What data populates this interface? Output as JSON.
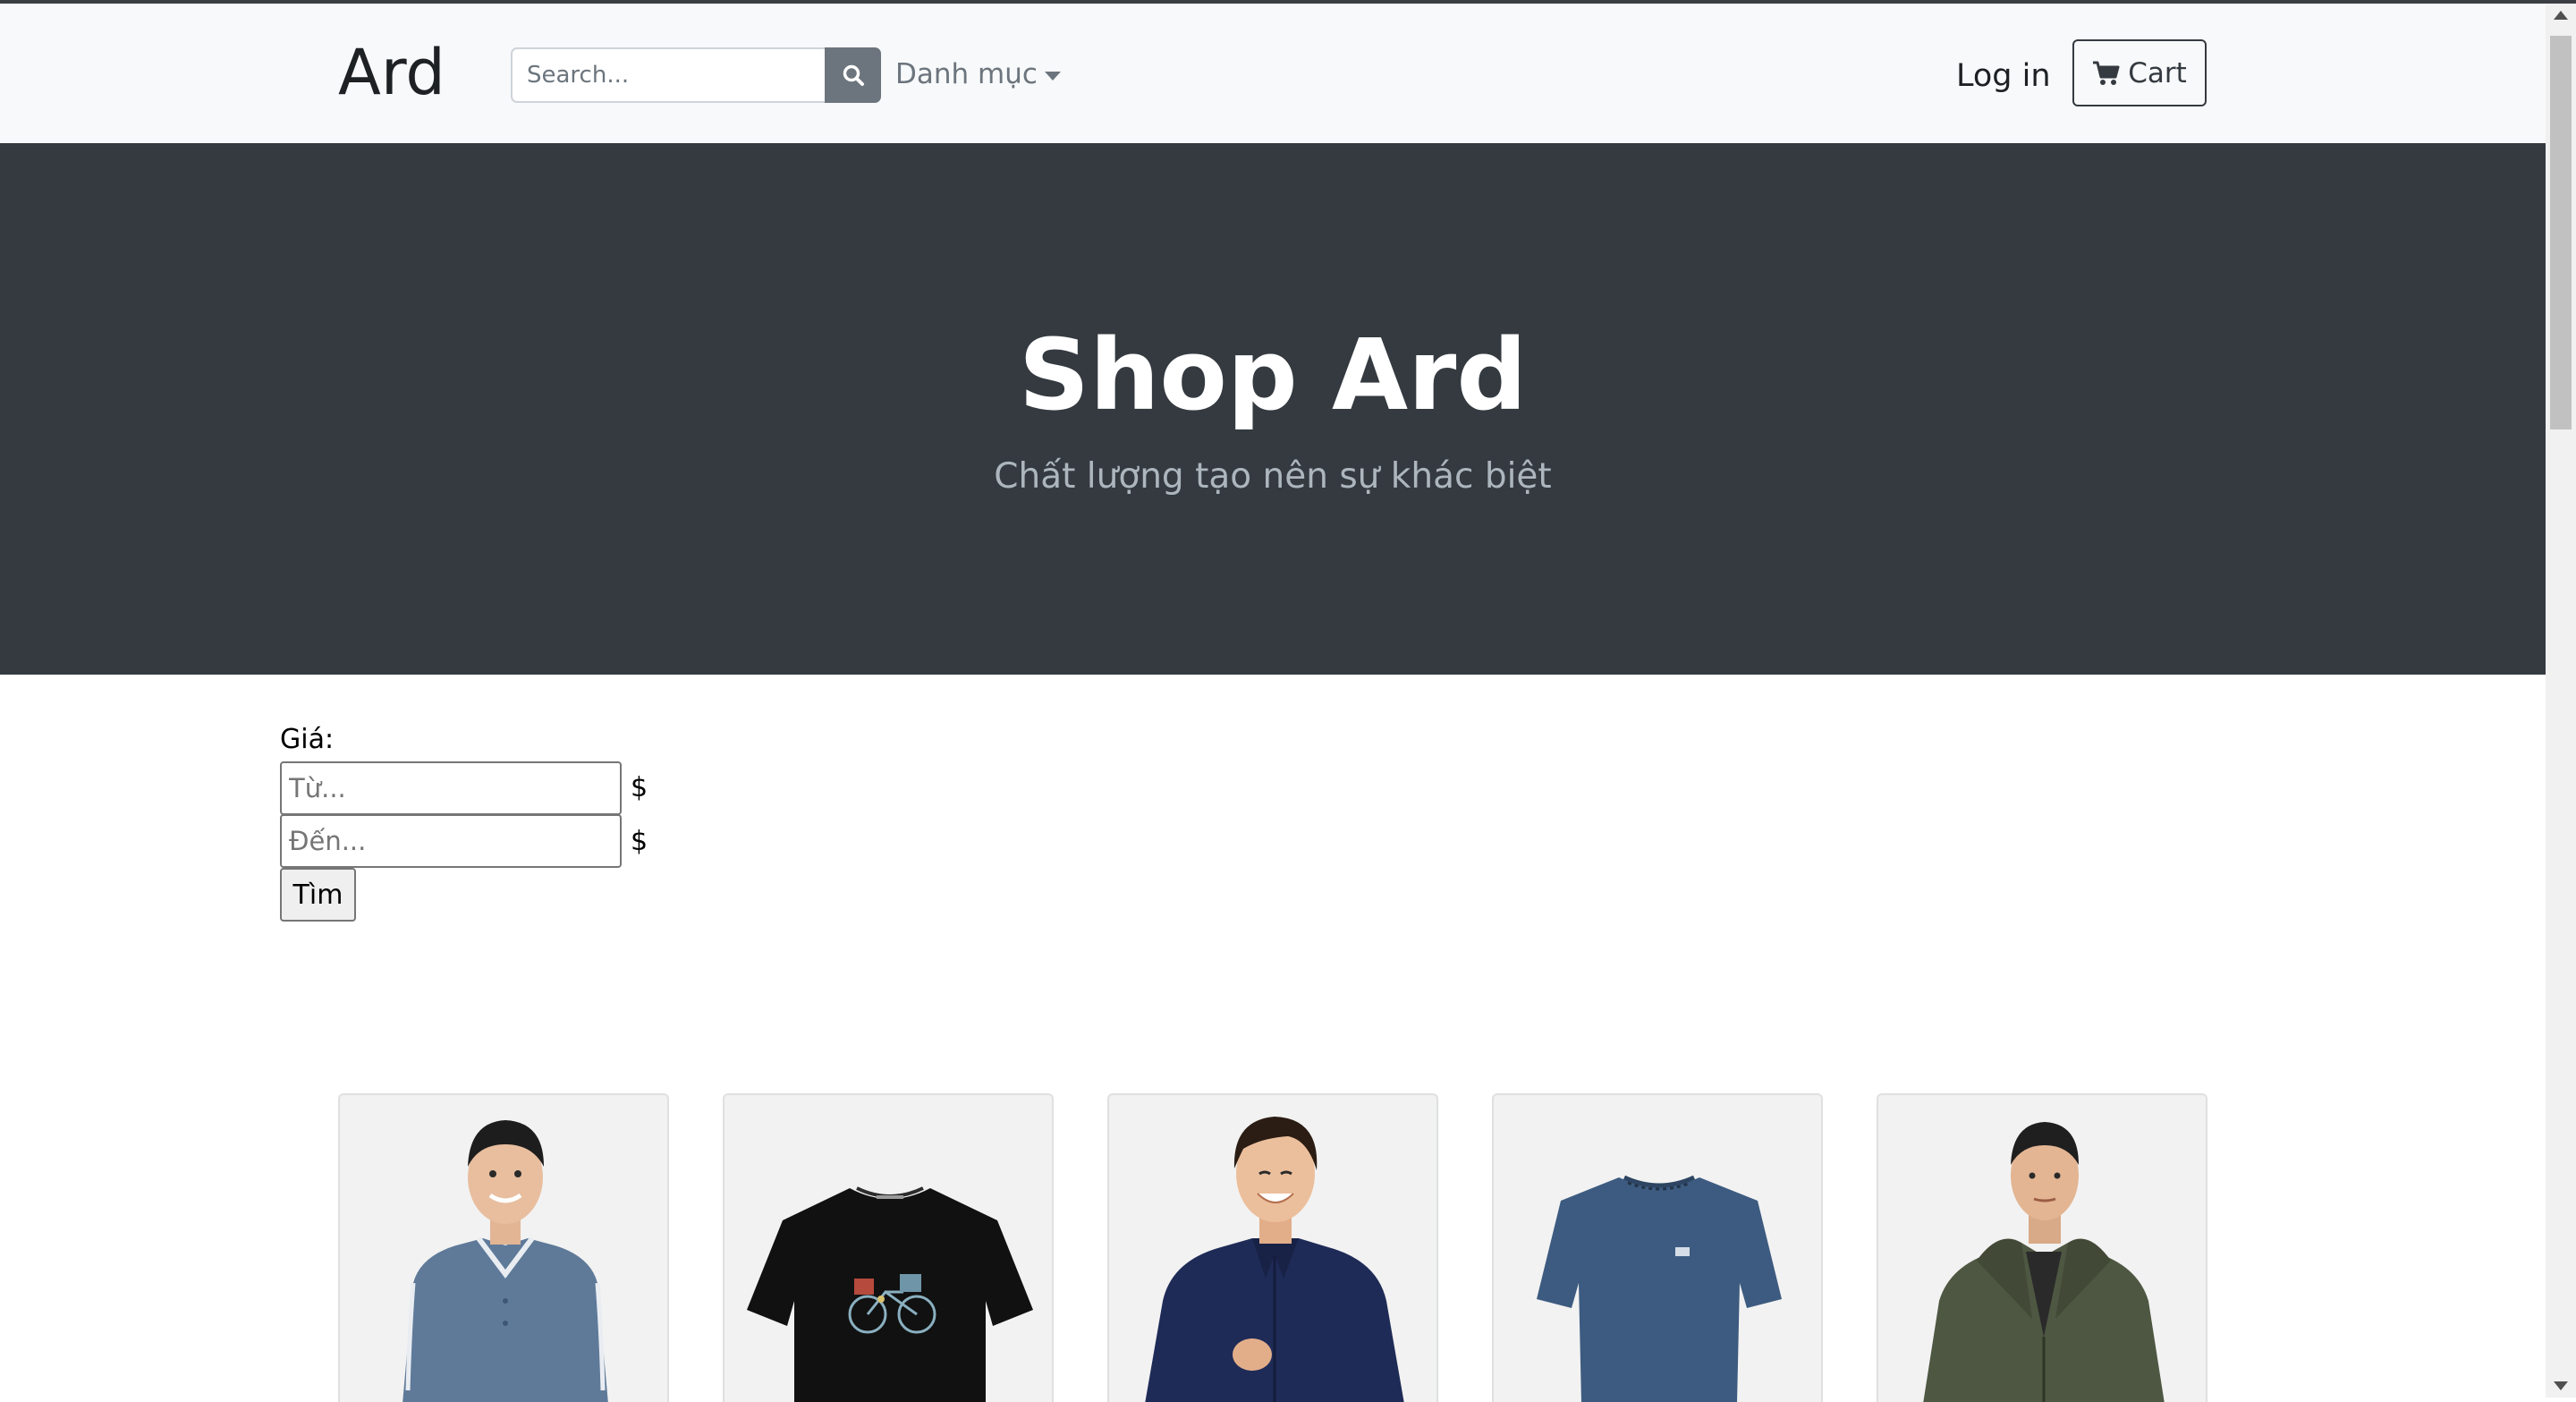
{
  "navbar": {
    "brand": "Ard",
    "search_placeholder": "Search...",
    "search_icon": "search-icon",
    "category_label": "Danh mục",
    "login_label": "Log in",
    "cart_label": "Cart",
    "cart_icon": "cart-icon"
  },
  "hero": {
    "title": "Shop Ard",
    "subtitle": "Chất lượng tạo nên sự khác biệt"
  },
  "filter": {
    "label": "Giá:",
    "from_placeholder": "Từ...",
    "to_placeholder": "Đến...",
    "currency": "$",
    "submit_label": "Tìm"
  },
  "products": [
    {
      "image": "man-in-grey-blue-polo-shirt"
    },
    {
      "image": "black-tshirt-with-bicycle-print"
    },
    {
      "image": "man-in-navy-shirt"
    },
    {
      "image": "blue-tshirt"
    },
    {
      "image": "man-in-olive-hooded-jacket"
    }
  ],
  "colors": {
    "navbar_bg": "#f8f9fa",
    "hero_bg": "#343a40",
    "search_button": "#6c757d"
  }
}
